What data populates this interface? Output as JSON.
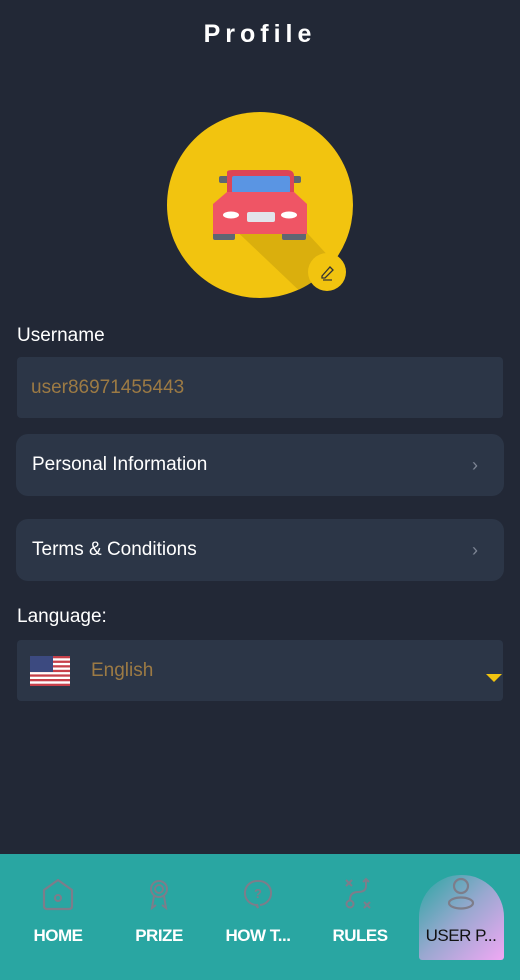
{
  "header": {
    "title": "Profile"
  },
  "avatar": {
    "icon": "car-icon",
    "edit_icon": "pencil-icon",
    "bg_color": "#f2c40f"
  },
  "username": {
    "label": "Username",
    "value": "user86971455443"
  },
  "menu": [
    {
      "label": "Personal Information",
      "icon": "chevron-right-icon"
    },
    {
      "label": "Terms & Conditions",
      "icon": "chevron-right-icon"
    }
  ],
  "language": {
    "label": "Language:",
    "selected": "English",
    "flag": "us-flag-icon",
    "dropdown_icon": "caret-down-icon"
  },
  "nav": {
    "items": [
      {
        "label": "HOME",
        "icon": "home-icon"
      },
      {
        "label": "PRIZE",
        "icon": "award-icon"
      },
      {
        "label": "HOW T...",
        "icon": "question-bubble-icon"
      },
      {
        "label": "RULES",
        "icon": "strategy-icon"
      },
      {
        "label": "USER P...",
        "icon": "user-icon",
        "active": true
      }
    ],
    "bg_color": "#29a6a2"
  },
  "colors": {
    "background": "#222836",
    "card": "#2c3647",
    "value_text": "#9c7a44",
    "accent": "#f2c40f"
  }
}
